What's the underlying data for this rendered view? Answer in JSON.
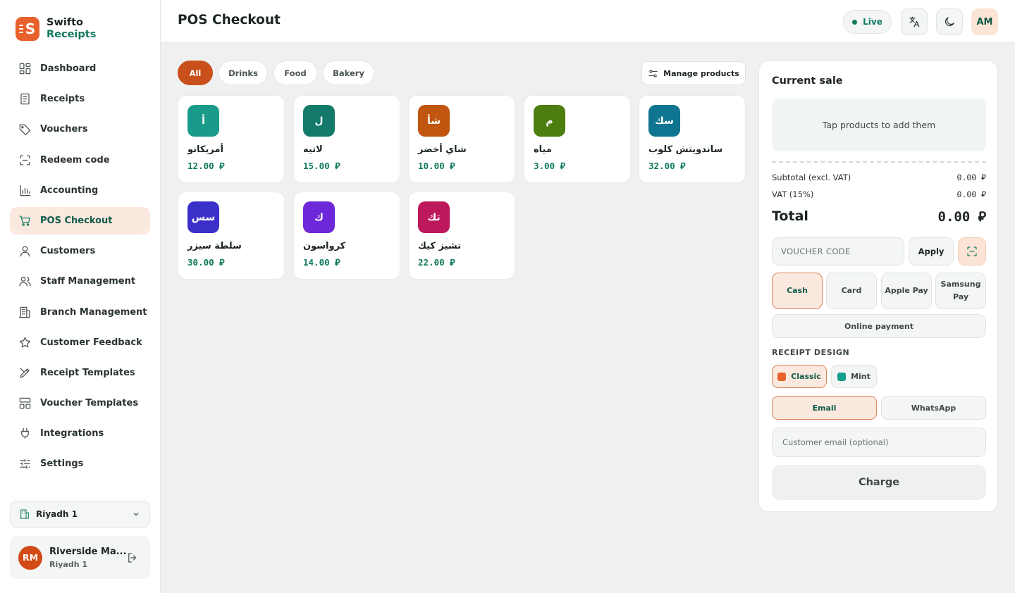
{
  "brand": {
    "line1": "Swifto",
    "line2": "Receipts",
    "logo_letter": "S"
  },
  "sidebar": {
    "items": [
      {
        "label": "Dashboard",
        "icon": "dashboard-icon"
      },
      {
        "label": "Receipts",
        "icon": "receipt-icon"
      },
      {
        "label": "Vouchers",
        "icon": "tag-icon"
      },
      {
        "label": "Redeem code",
        "icon": "scan-icon"
      },
      {
        "label": "Accounting",
        "icon": "bar-chart-icon"
      },
      {
        "label": "POS Checkout",
        "icon": "cart-icon",
        "active": true
      },
      {
        "label": "Customers",
        "icon": "user-icon"
      },
      {
        "label": "Staff Management",
        "icon": "users-icon"
      },
      {
        "label": "Branch Management",
        "icon": "building-icon"
      },
      {
        "label": "Customer Feedback",
        "icon": "star-icon"
      },
      {
        "label": "Receipt Templates",
        "icon": "brush-icon"
      },
      {
        "label": "Voucher Templates",
        "icon": "layout-icon"
      },
      {
        "label": "Integrations",
        "icon": "plug-icon"
      },
      {
        "label": "Settings",
        "icon": "sliders-icon"
      }
    ],
    "branch": "Riyadh 1",
    "user": {
      "initials": "RM",
      "name": "Riverside Ma...",
      "branch": "Riyadh 1"
    }
  },
  "header": {
    "title": "POS Checkout",
    "live_label": "Live",
    "avatar_initials": "AM"
  },
  "filters": [
    {
      "label": "All",
      "active": true
    },
    {
      "label": "Drinks"
    },
    {
      "label": "Food"
    },
    {
      "label": "Bakery"
    }
  ],
  "manage_products_label": "Manage products",
  "currency_symbol": "⃁",
  "products": [
    {
      "tile": "أ",
      "name": "أمريكانو",
      "price": "12.00",
      "color": "#1a9a8a"
    },
    {
      "tile": "ل",
      "name": "لاتيه",
      "price": "15.00",
      "color": "#137a6a"
    },
    {
      "tile": "شأ",
      "name": "شاي أخضر",
      "price": "10.00",
      "color": "#c0560f"
    },
    {
      "tile": "م",
      "name": "مياه",
      "price": "3.00",
      "color": "#4d7c0f"
    },
    {
      "tile": "سك",
      "name": "ساندويتش كلوب",
      "price": "32.00",
      "color": "#0e7490"
    },
    {
      "tile": "سس",
      "name": "سلطة سيزر",
      "price": "30.00",
      "color": "#3b2fc9"
    },
    {
      "tile": "ك",
      "name": "كرواسون",
      "price": "14.00",
      "color": "#6d28d9"
    },
    {
      "tile": "تك",
      "name": "تشيز كيك",
      "price": "22.00",
      "color": "#be185d"
    }
  ],
  "sale": {
    "title": "Current sale",
    "empty_text": "Tap products to add them",
    "subtotal_label": "Subtotal (excl. VAT)",
    "subtotal_value": "0.00 ⃁",
    "vat_label": "VAT (15%)",
    "vat_value": "0.00 ⃁",
    "total_label": "Total",
    "total_value": "0.00 ⃁",
    "voucher_placeholder": "VOUCHER CODE",
    "apply_label": "Apply",
    "payment_methods": [
      {
        "label": "Cash",
        "active": true
      },
      {
        "label": "Card"
      },
      {
        "label": "Apple Pay"
      },
      {
        "label": "Samsung Pay"
      }
    ],
    "online_payment_label": "Online payment",
    "receipt_design_label": "RECEIPT DESIGN",
    "designs": [
      {
        "label": "Classic",
        "color": "#e8612c",
        "active": true
      },
      {
        "label": "Mint",
        "color": "#14a08a"
      }
    ],
    "channels": [
      {
        "label": "Email",
        "active": true
      },
      {
        "label": "WhatsApp"
      }
    ],
    "email_placeholder": "Customer email (optional)",
    "charge_label": "Charge"
  }
}
